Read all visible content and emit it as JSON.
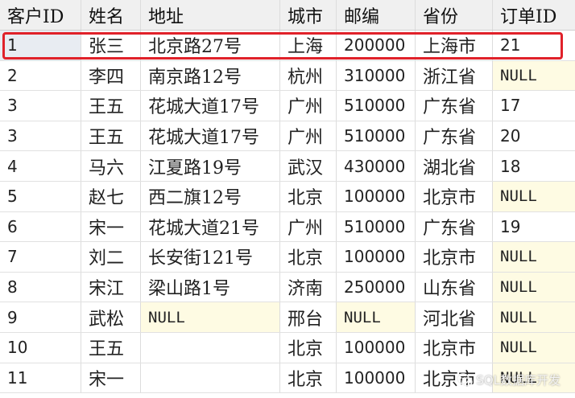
{
  "table": {
    "columns": [
      "客户ID",
      "姓名",
      "地址",
      "城市",
      "邮编",
      "省份",
      "订单ID"
    ],
    "rows": [
      [
        "1",
        "张三",
        "北京路27号",
        "上海",
        "200000",
        "上海市",
        "21"
      ],
      [
        "2",
        "李四",
        "南京路12号",
        "杭州",
        "310000",
        "浙江省",
        "NULL"
      ],
      [
        "3",
        "王五",
        "花城大道17号",
        "广州",
        "510000",
        "广东省",
        "17"
      ],
      [
        "3",
        "王五",
        "花城大道17号",
        "广州",
        "510000",
        "广东省",
        "20"
      ],
      [
        "4",
        "马六",
        "江夏路19号",
        "武汉",
        "430000",
        "湖北省",
        "18"
      ],
      [
        "5",
        "赵七",
        "西二旗12号",
        "北京",
        "100000",
        "北京市",
        "NULL"
      ],
      [
        "6",
        "宋一",
        "花城大道21号",
        "广州",
        "510000",
        "广东省",
        "19"
      ],
      [
        "7",
        "刘二",
        "长安街121号",
        "北京",
        "100000",
        "北京市",
        "NULL"
      ],
      [
        "8",
        "宋江",
        "梁山路1号",
        "济南",
        "250000",
        "山东省",
        "NULL"
      ],
      [
        "9",
        "武松",
        "NULL",
        "邢台",
        "NULL",
        "河北省",
        "NULL"
      ],
      [
        "10",
        "王五",
        "",
        "北京",
        "100000",
        "北京市",
        "NULL"
      ],
      [
        "11",
        "宋一",
        "",
        "北京",
        "100000",
        "北京市",
        "NULL"
      ]
    ],
    "selected_row": 0
  },
  "colors": {
    "highlight_border": "#e0212a",
    "null_cell_bg": "#fefbe3",
    "header_bg": "#f0f0f0"
  },
  "watermark": {
    "icon": "wechat-icon",
    "text": "SQL数据库开发"
  }
}
